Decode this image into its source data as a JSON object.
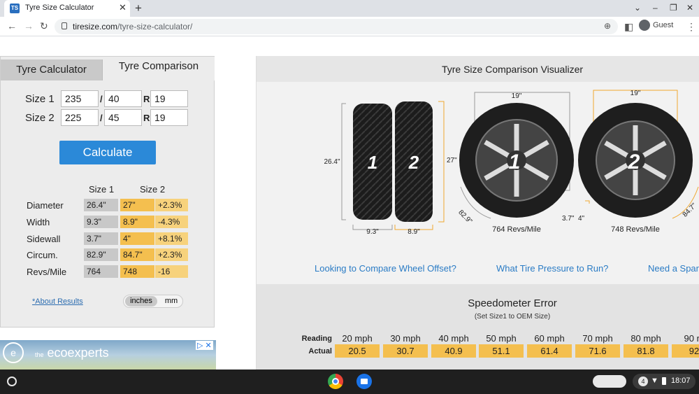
{
  "browser": {
    "tab_title": "Tyre Size Calculator",
    "favicon": "TS",
    "url_domain": "tiresize.com",
    "url_path": "/tyre-size-calculator/",
    "profile": "Guest"
  },
  "calculator": {
    "tabs": [
      "Tyre Calculator",
      "Tyre Comparison"
    ],
    "active_tab": "Tyre Comparison",
    "size1": {
      "label": "Size 1",
      "width": "235",
      "aspect": "40",
      "rim": "19"
    },
    "size2": {
      "label": "Size 2",
      "width": "225",
      "aspect": "45",
      "rim": "19"
    },
    "sep_slash": "/",
    "sep_r": "R",
    "calculate_label": "Calculate",
    "col_headers": [
      "Size 1",
      "Size 2"
    ],
    "rows": [
      {
        "label": "Diameter",
        "s1": "26.4\"",
        "s2": "27\"",
        "diff": "+2.3%"
      },
      {
        "label": "Width",
        "s1": "9.3\"",
        "s2": "8.9\"",
        "diff": "-4.3%"
      },
      {
        "label": "Sidewall",
        "s1": "3.7\"",
        "s2": "4\"",
        "diff": "+8.1%"
      },
      {
        "label": "Circum.",
        "s1": "82.9\"",
        "s2": "84.7\"",
        "diff": "+2.3%"
      },
      {
        "label": "Revs/Mile",
        "s1": "764",
        "s2": "748",
        "diff": "-16"
      }
    ],
    "about_link": "*About Results",
    "units": [
      "inches",
      "mm"
    ],
    "selected_unit": "inches"
  },
  "ad": {
    "brand": "ecoexperts",
    "brand_prefix": "the"
  },
  "visualizer": {
    "title": "Tyre Size Comparison Visualizer",
    "tyre1": {
      "number": "1",
      "diameter": "26.4\"",
      "width": "9.3\"",
      "rim": "19\"",
      "circum": "82.9\"",
      "sidewall": "3.7\"",
      "revs": "764 Revs/Mile"
    },
    "tyre2": {
      "number": "2",
      "diameter": "27\"",
      "width": "8.9\"",
      "rim": "19\"",
      "circum": "84.7\"",
      "sidewall": "4\"",
      "revs": "748 Revs/Mile"
    },
    "links": [
      "Looking to Compare Wheel Offset?",
      "What Tire Pressure to Run?",
      "Need a Spar"
    ]
  },
  "speedometer": {
    "title": "Speedometer Error",
    "subtitle": "(Set Size1 to OEM Size)",
    "reading_label": "Reading",
    "actual_label": "Actual",
    "readings": [
      "20 mph",
      "30 mph",
      "40 mph",
      "50 mph",
      "60 mph",
      "70 mph",
      "80 mph",
      "90 m"
    ],
    "actuals": [
      "20.5",
      "30.7",
      "40.9",
      "51.1",
      "61.4",
      "71.6",
      "81.8",
      "92"
    ]
  },
  "taskbar": {
    "notifications": "4",
    "clock": "18:07"
  },
  "colors": {
    "accent": "#2b89d8",
    "highlight": "#f4bf4f",
    "link": "#2b7cc5"
  }
}
